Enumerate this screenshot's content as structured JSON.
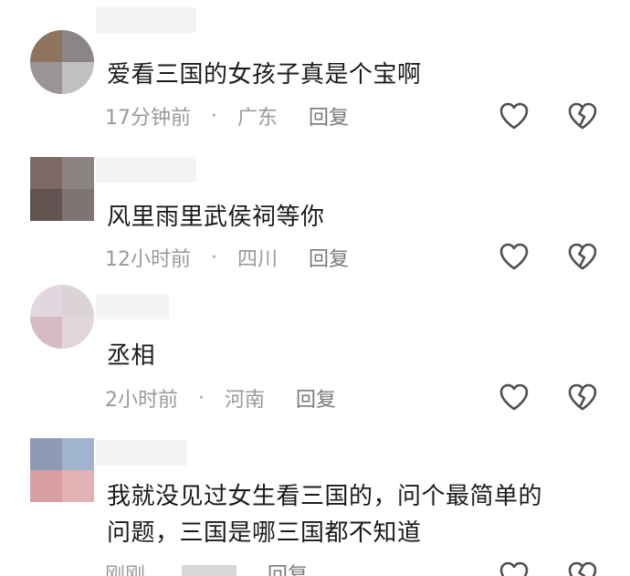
{
  "comments": [
    {
      "text": "爱看三国的女孩子真是个宝啊",
      "time": "17分钟前",
      "dot": "·",
      "location": "广东",
      "reply": "回复",
      "avatar_colors": [
        "#8e735e",
        "#8b8686",
        "#9a9494",
        "#c2bfbf"
      ]
    },
    {
      "text": "风里雨里武侯祠等你",
      "time": "12小时前",
      "dot": "·",
      "location": "四川",
      "reply": "回复",
      "avatar_colors": [
        "#7d6a64",
        "#8c8480",
        "#625350",
        "#7e7474"
      ]
    },
    {
      "text": "丞相",
      "time": "2小时前",
      "dot": "·",
      "location": "河南",
      "reply": "回复",
      "avatar_colors": [
        "#e2d7df",
        "#dcd3d8",
        "#d7bbc4",
        "#e1d6da"
      ]
    },
    {
      "text_line1": "我就没见过女生看三国的，问个最简单的",
      "text_line2": "问题，三国是哪三国都不知道",
      "time": "刚刚",
      "reply": "回复",
      "avatar_colors": [
        "#8f9ab4",
        "#a0b4cf",
        "#d99da4",
        "#e1b1b3"
      ]
    }
  ],
  "icons": {
    "like": "heart-outline-icon",
    "dislike": "broken-heart-outline-icon"
  },
  "colors": {
    "text": "#1b1b1b",
    "meta": "#9a9a9a",
    "icon": "#505050"
  }
}
